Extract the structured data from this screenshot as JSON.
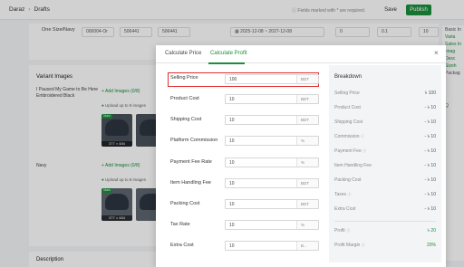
{
  "header": {
    "breadcrumb": [
      "Daraz",
      "Drafts"
    ],
    "required_note": "Fields marked with * are required.",
    "save_label": "Save",
    "publish_label": "Publish"
  },
  "variant_row": {
    "size_label": "One Size/Navy",
    "seller_sku": "000004-Or",
    "field2": "506441",
    "field3": "506441",
    "date_start": "2025-12-08",
    "date_sep": "~",
    "date_end": "2027-12-08",
    "field5": "0",
    "field6": "0.1",
    "field7": "10"
  },
  "variant_images": {
    "title": "Variant Images",
    "items": [
      {
        "name": "I Paused My Game to Be Here Embroidered Black",
        "add_label": "+ Add Images (0/8)",
        "upload_note": "Upload up to 8 images",
        "main_badge": "Main",
        "size": "377 × 484"
      },
      {
        "name": "Navy",
        "add_label": "+ Add Images (0/8)",
        "upload_note": "Upload up to 8 images",
        "main_badge": "Main",
        "size": "377 × 484"
      }
    ]
  },
  "description": {
    "title": "Description"
  },
  "side_panel": [
    "Basic In",
    "Varia",
    "Sales In",
    "Imag",
    "Desc",
    "Sizeh",
    "Packag",
    "Q"
  ],
  "modal": {
    "tabs": [
      "Calculate Price",
      "Calculate Profit"
    ],
    "active_tab": 1,
    "fields": [
      {
        "label": "Selling Price",
        "value": "100",
        "unit": "BDT"
      },
      {
        "label": "Product Cost",
        "value": "10",
        "unit": "BDT"
      },
      {
        "label": "Shipping Cost",
        "value": "10",
        "unit": "BDT"
      },
      {
        "label": "Platform Commission",
        "value": "10",
        "unit": "%"
      },
      {
        "label": "Payment Fee Rate",
        "value": "10",
        "unit": "%"
      },
      {
        "label": "Item Handling Fee",
        "value": "10",
        "unit": "BDT"
      },
      {
        "label": "Packing Cost",
        "value": "10",
        "unit": "BDT"
      },
      {
        "label": "Tax Rate",
        "value": "10",
        "unit": "%"
      },
      {
        "label": "Extra Cost",
        "value": "10",
        "unit": "B..."
      }
    ],
    "breakdown": {
      "title": "Breakdown",
      "rows": [
        {
          "label": "Selling Price",
          "value": "৳ 100"
        },
        {
          "label": "Product Cost",
          "value": "- ৳ 10"
        },
        {
          "label": "Shipping Cost",
          "value": "- ৳ 10"
        },
        {
          "label": "Commission",
          "value": "- ৳ 10"
        },
        {
          "label": "Payment Fee",
          "value": "- ৳ 10"
        },
        {
          "label": "Item Handling Fee",
          "value": "- ৳ 10"
        },
        {
          "label": "Packing Cost",
          "value": "- ৳ 10"
        },
        {
          "label": "Taxes",
          "value": "- ৳ 10"
        },
        {
          "label": "Extra Cost",
          "value": "- ৳ 10"
        }
      ],
      "profit_label": "Profit",
      "profit_value": "৳ 20",
      "margin_label": "Profit Margin",
      "margin_value": "20%"
    }
  },
  "colors": {
    "accent": "#1a8e3b",
    "highlight": "#e02d2d"
  }
}
